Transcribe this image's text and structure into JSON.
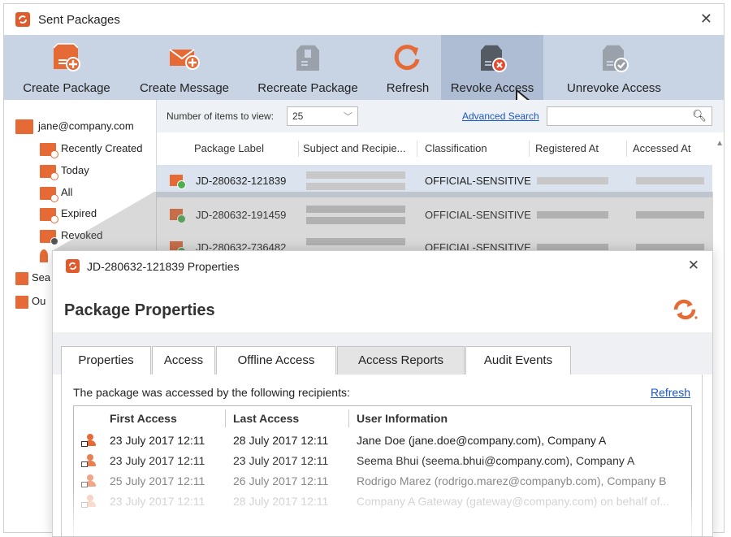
{
  "window": {
    "title": "Sent Packages"
  },
  "ribbon": {
    "buttons": [
      {
        "label": "Create Package",
        "icon": "create-package-icon"
      },
      {
        "label": "Create Message",
        "icon": "create-message-icon"
      },
      {
        "label": "Recreate Package",
        "icon": "recreate-package-icon"
      },
      {
        "label": "Refresh",
        "icon": "refresh-icon"
      },
      {
        "label": "Revoke Access",
        "icon": "revoke-access-icon"
      },
      {
        "label": "Unrevoke Access",
        "icon": "unrevoke-access-icon"
      }
    ],
    "active": "Revoke Access"
  },
  "sidebar": {
    "account": "jane@company.com",
    "items": [
      {
        "label": "Recently Created"
      },
      {
        "label": "Today"
      },
      {
        "label": "All"
      },
      {
        "label": "Expired"
      },
      {
        "label": "Revoked"
      }
    ],
    "partial_items": [
      {
        "label": "Sea"
      },
      {
        "label": "Ou"
      }
    ]
  },
  "filter": {
    "items_label": "Number of items to view:",
    "items_value": "25",
    "advanced_search": "Advanced Search",
    "search_placeholder": ""
  },
  "packages": {
    "columns": [
      "Package Label",
      "Subject and Recipie...",
      "Classification",
      "Registered At",
      "Accessed At"
    ],
    "rows": [
      {
        "label": "JD-280632-121839",
        "classification": "OFFICIAL-SENSITIVE",
        "selected": true
      },
      {
        "label": "JD-280632-191459",
        "classification": "OFFICIAL-SENSITIVE",
        "selected": false
      },
      {
        "label": "JD-280632-736482",
        "classification": "OFFICIAL-SENSITIVE",
        "selected": false
      }
    ]
  },
  "dialog": {
    "title": "JD-280632-121839 Properties",
    "heading": "Package Properties",
    "tabs": [
      {
        "label": "Properties"
      },
      {
        "label": "Access"
      },
      {
        "label": "Offline Access"
      },
      {
        "label": "Access Reports"
      },
      {
        "label": "Audit Events"
      }
    ],
    "active_tab": "Access Reports",
    "message": "The package was accessed by the following recipients:",
    "refresh": "Refresh",
    "report_columns": [
      "First Access",
      "Last Access",
      "User Information"
    ],
    "report_rows": [
      {
        "first": "23 July 2017 12:11",
        "last": "28 July 2017 12:11",
        "user": "Jane Doe (jane.doe@company.com), Company A"
      },
      {
        "first": "23 July 2017 12:11",
        "last": "23 July 2017 12:11",
        "user": "Seema Bhui (seema.bhui@company.com), Company A"
      },
      {
        "first": "25 July 2017 12:11",
        "last": "26 July 2017 12:11",
        "user": "Rodrigo Marez (rodrigo.marez@companyb.com), Company B"
      },
      {
        "first": "23 July 2017 12:11",
        "last": "28 July 2017 12:11",
        "user": "Company A Gateway (gateway@company.com) on behalf of..."
      }
    ]
  },
  "colors": {
    "accent": "#e66a36",
    "ribbon": "#c8d4e4",
    "selection": "#dbe3ee",
    "link": "#1a56c4",
    "ok": "#4caf50"
  }
}
